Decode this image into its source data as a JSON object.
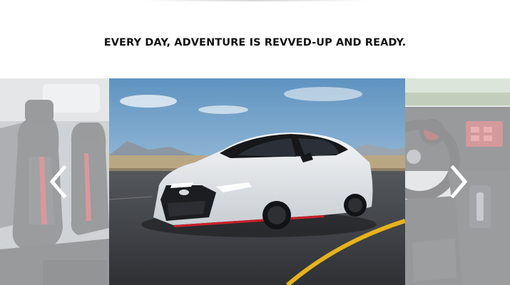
{
  "page": {
    "headline": "EVERY DAY, ADVENTURE IS REVVED-UP AND READY."
  },
  "carousel": {
    "prev_icon": "chevron-left-icon",
    "next_icon": "chevron-right-icon",
    "slides": [
      {
        "subject": "interior-seats",
        "state": "faded"
      },
      {
        "subject": "sedan-on-road",
        "state": "active"
      },
      {
        "subject": "dashboard-steering-wheel",
        "state": "faded"
      }
    ]
  },
  "colors": {
    "heading": "#111111",
    "sky_top": "#6a9cc6",
    "car_body": "#e9ecef",
    "road": "#3a3d42",
    "lane_line": "#e6b21c",
    "accent_red": "#c8202a"
  }
}
